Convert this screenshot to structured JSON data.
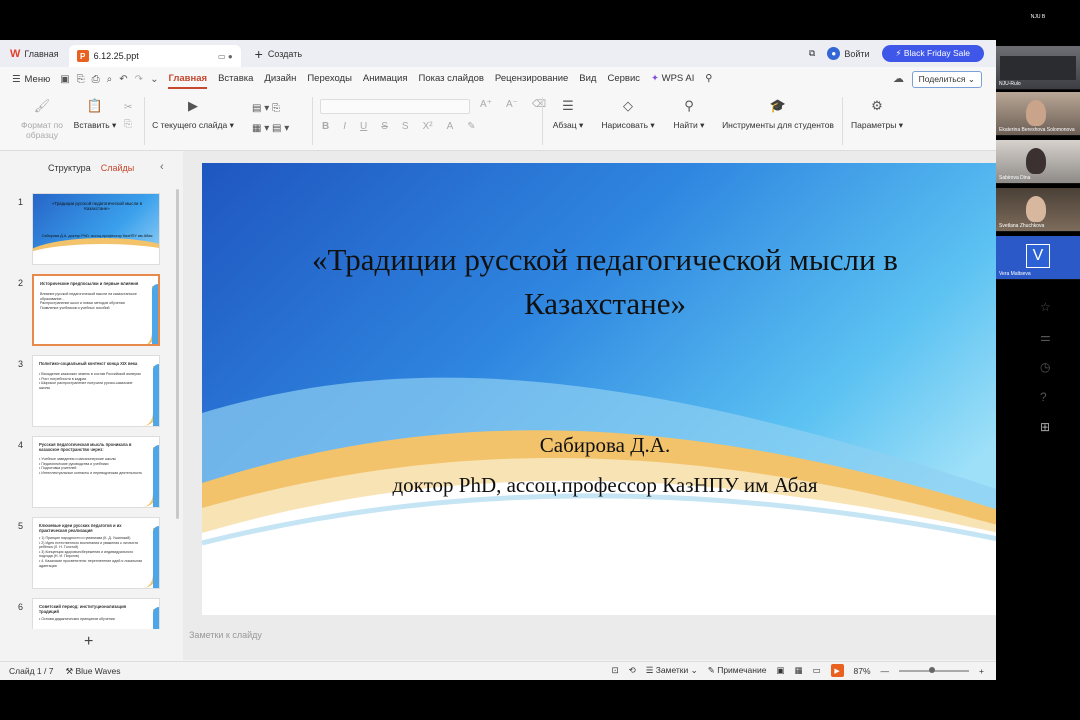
{
  "topbar": {
    "home_tab": "Главная",
    "doc_tab": "6.12.25.ppt",
    "new_tab": "Создать",
    "login": "Войти",
    "promo": "Black Friday Sale"
  },
  "menubar": {
    "menu": "Меню",
    "tabs": [
      "Главная",
      "Вставка",
      "Дизайн",
      "Переходы",
      "Анимация",
      "Показ слайдов",
      "Рецензирование",
      "Вид",
      "Сервис",
      "WPS AI"
    ],
    "share": "Поделиться"
  },
  "ribbon": {
    "format_painter": "Формат по образцу",
    "paste": "Вставить",
    "from_current": "С текущего слайда",
    "paragraph": "Абзац",
    "draw": "Нарисовать",
    "find": "Найти",
    "student_tools": "Инструменты для студентов",
    "params": "Параметры"
  },
  "sidebar": {
    "tab_outline": "Структура",
    "tab_slides": "Слайды",
    "thumbs": [
      {
        "num": "1",
        "title": "«Традиции русской педагогической мысли в Казахстане»",
        "sub": "Сабирова Д.А. доктор PhD, ассоц.профессор КазНПУ им Абая"
      },
      {
        "num": "2",
        "title": "Исторические предпосылки и первые влияния",
        "lines": [
          "Влияние русской педагогической мысли на казахстанское образование...",
          "Распространение школ и новых методов обучения",
          "Появление учебников и учебных пособий"
        ]
      },
      {
        "num": "3",
        "title": "Политико-социальный контекст конца XIX века",
        "lines": [
          "• Вхождение казахских земель в состав Российской империи",
          "• Рост потребности в кадрах",
          "• Широкое распространение получили русско-казахские школы"
        ]
      },
      {
        "num": "4",
        "title": "Русская педагогическая мысль проникала в казахское пространство через:",
        "lines": [
          "• Учебные заведения и миссионерские школы",
          "• Педагогические руководства и учебники",
          "• Подготовка учителей",
          "• Интеллектуальные контакты и переводческая деятельность"
        ]
      },
      {
        "num": "5",
        "title": "Ключевые идеи русских педагогов и их практическая реализация",
        "lines": [
          "• 1) Принцип народности и гуманизма (К. Д. Ушинский)",
          "• 2) Идея естественного воспитания и уважения к личности ребёнка (Л. Н. Толстой)",
          "• 3) Концепция здоровьесбережения и индивидуального подхода (Н. И. Пирогов)",
          "• 4. Казахские просветители: переплетение идей и локальная адаптация"
        ]
      },
      {
        "num": "6",
        "title": "Советский период: институционализация традиций",
        "lines": [
          "• Основа дидактических принципов обучения"
        ]
      }
    ]
  },
  "slide": {
    "title": "«Традиции русской педагогической мысли в Казахстане»",
    "author": "Сабирова Д.А.",
    "position": "доктор PhD, ассоц.профессор КазНПУ им Абая"
  },
  "notes_placeholder": "Заметки к слайду",
  "status": {
    "slide_count": "Слайд 1 / 7",
    "theme": "Blue Waves",
    "notes": "Заметки",
    "comment": "Примечание",
    "zoom": "87%"
  },
  "video_call": {
    "top_label": "NJU B",
    "participants": [
      "NJU-Rulo",
      "Ekaterina Bereshova Solomonova",
      "Sabirova Dina",
      "Svetlana Zhuchkova",
      "Vera Maltseva"
    ],
    "avatar_letter": "V"
  },
  "colors": {
    "accent": "#c5482f",
    "promo": "#3f57e8",
    "slide_blue": "#2766c8",
    "wave_gold": "#f2c36b"
  }
}
